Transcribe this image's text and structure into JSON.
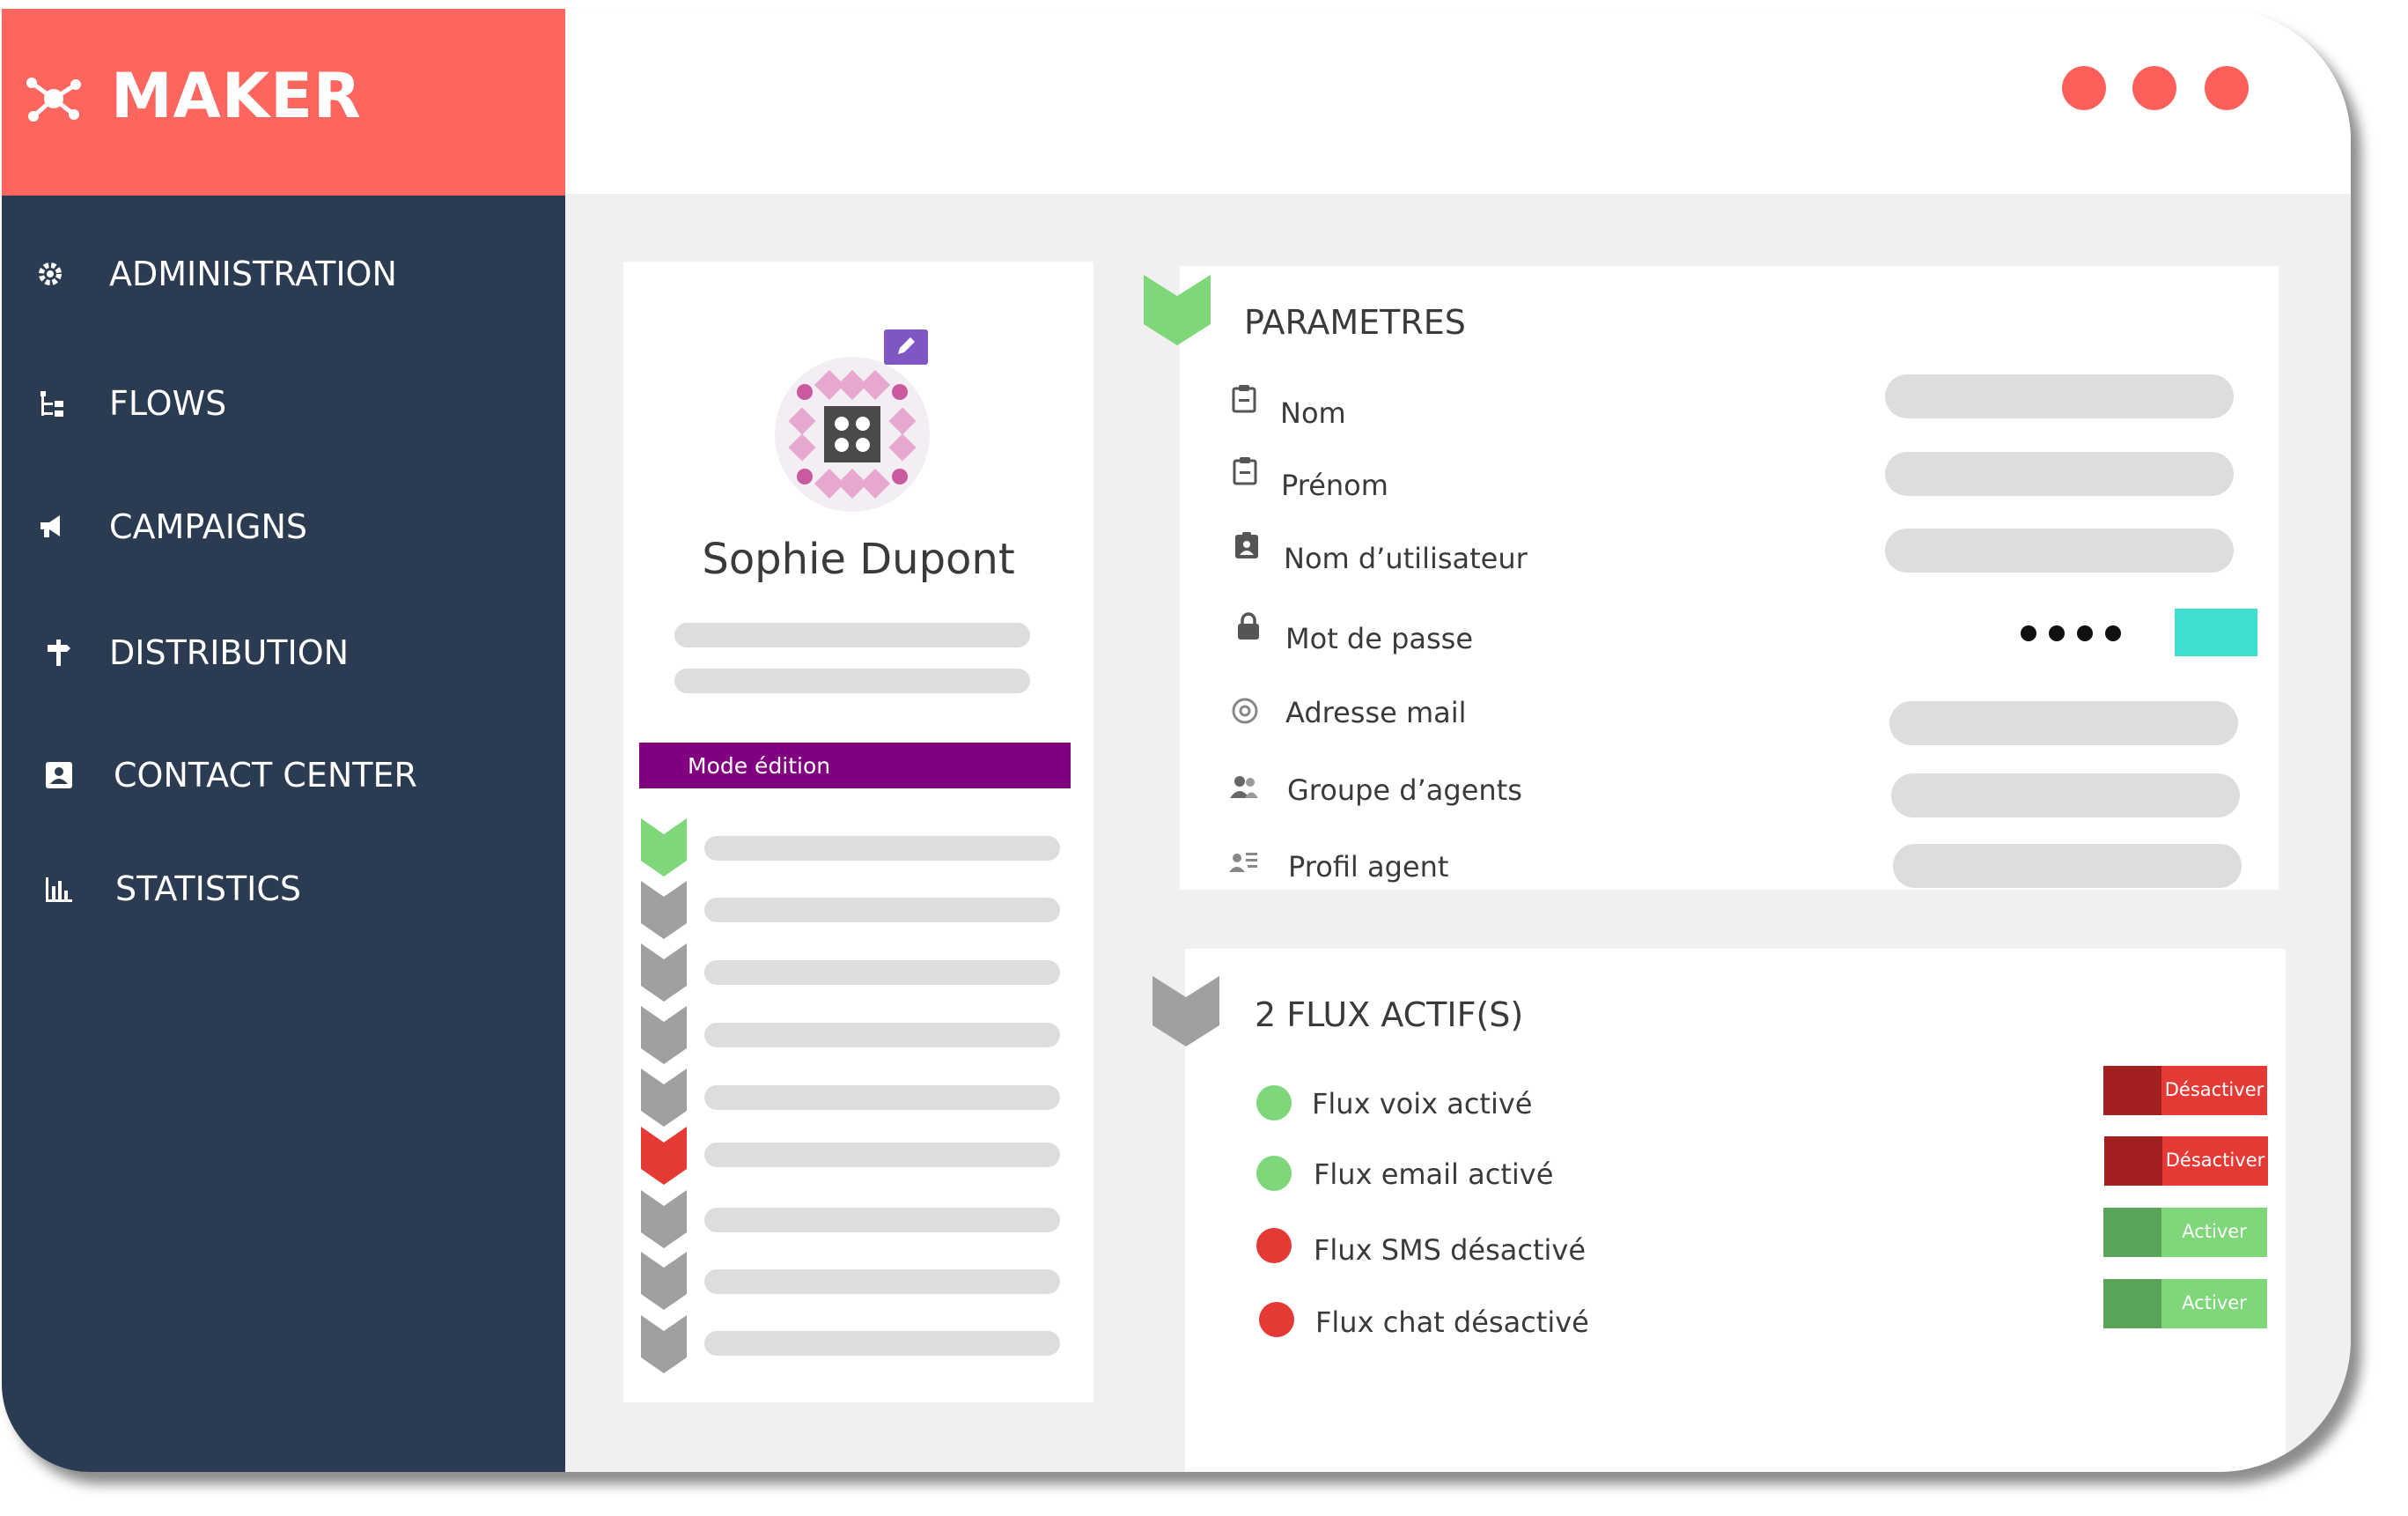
{
  "app": {
    "name": "MAKER"
  },
  "colors": {
    "brand": "#fd655f",
    "sidebar": "#2b3b51",
    "accent_purple": "#800080",
    "green": "#7ed87a",
    "red": "#e53935",
    "teal": "#40e0d0",
    "gray_chevron": "#a0a0a0"
  },
  "window_controls": [
    "close-dot",
    "minimize-dot",
    "maximize-dot"
  ],
  "sidebar": {
    "items": [
      {
        "label": "ADMINISTRATION",
        "icon": "gear-icon"
      },
      {
        "label": "FLOWS",
        "icon": "flow-tree-icon"
      },
      {
        "label": "CAMPAIGNS",
        "icon": "megaphone-icon"
      },
      {
        "label": "DISTRIBUTION",
        "icon": "signpost-icon"
      },
      {
        "label": "CONTACT CENTER",
        "icon": "contact-card-icon"
      },
      {
        "label": "STATISTICS",
        "icon": "bar-chart-icon"
      }
    ]
  },
  "profile": {
    "name": "Sophie Dupont",
    "mode_label": "Mode édition",
    "steps": [
      "done",
      "pending",
      "pending",
      "pending",
      "pending",
      "error",
      "pending",
      "pending",
      "pending"
    ]
  },
  "parametres": {
    "title": "PARAMETRES",
    "fields": [
      {
        "label": "Nom",
        "icon": "clipboard-icon"
      },
      {
        "label": "Prénom",
        "icon": "clipboard-icon"
      },
      {
        "label": "Nom d’utilisateur",
        "icon": "id-badge-icon"
      },
      {
        "label": "Mot de passe",
        "icon": "lock-icon"
      },
      {
        "label": "Adresse mail",
        "icon": "at-icon"
      },
      {
        "label": "Groupe d’agents",
        "icon": "people-icon"
      },
      {
        "label": "Profil agent",
        "icon": "profile-list-icon"
      }
    ]
  },
  "flux": {
    "title": "2 FLUX ACTIF(S)",
    "items": [
      {
        "label": "Flux voix activé",
        "status": "active",
        "action": "Désactiver"
      },
      {
        "label": "Flux email activé",
        "status": "active",
        "action": "Désactiver"
      },
      {
        "label": "Flux SMS désactivé",
        "status": "inactive",
        "action": "Activer"
      },
      {
        "label": "Flux chat désactivé",
        "status": "inactive",
        "action": "Activer"
      }
    ]
  }
}
